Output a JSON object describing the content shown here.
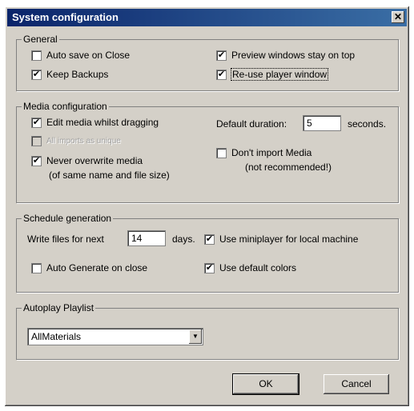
{
  "window": {
    "title": "System configuration",
    "close_glyph": "✕"
  },
  "general": {
    "label": "General",
    "auto_save": {
      "label": "Auto save on Close",
      "checked": false
    },
    "keep_backups": {
      "label": "Keep Backups",
      "checked": true
    },
    "preview_on_top": {
      "label": "Preview windows stay on top",
      "checked": true
    },
    "reuse_player": {
      "label": "Re-use player window",
      "checked": true
    }
  },
  "media": {
    "label": "Media configuration",
    "edit_dragging": {
      "label": "Edit media whilst dragging",
      "checked": true
    },
    "disabled_option": {
      "label": "All imports as unique",
      "checked": false
    },
    "never_overwrite": {
      "label": "Never overwrite media",
      "sublabel": "(of same name and file size)",
      "checked": true
    },
    "default_duration_label": "Default duration:",
    "default_duration_value": "5",
    "seconds_label": "seconds.",
    "dont_import": {
      "label": "Don't import Media",
      "sublabel": "(not recommended!)",
      "checked": false
    }
  },
  "schedule": {
    "label": "Schedule generation",
    "write_files_label": "Write files for next",
    "write_files_value": "14",
    "days_label": "days.",
    "use_miniplayer": {
      "label": "Use miniplayer for local machine",
      "checked": true
    },
    "auto_generate": {
      "label": "Auto Generate on close",
      "checked": false
    },
    "use_default_colors": {
      "label": "Use default colors",
      "checked": true
    }
  },
  "autoplay": {
    "label": "Autoplay Playlist",
    "selected": "AllMaterials"
  },
  "buttons": {
    "ok": "OK",
    "cancel": "Cancel"
  },
  "glyphs": {
    "check": "✔",
    "dropdown": "▼"
  }
}
